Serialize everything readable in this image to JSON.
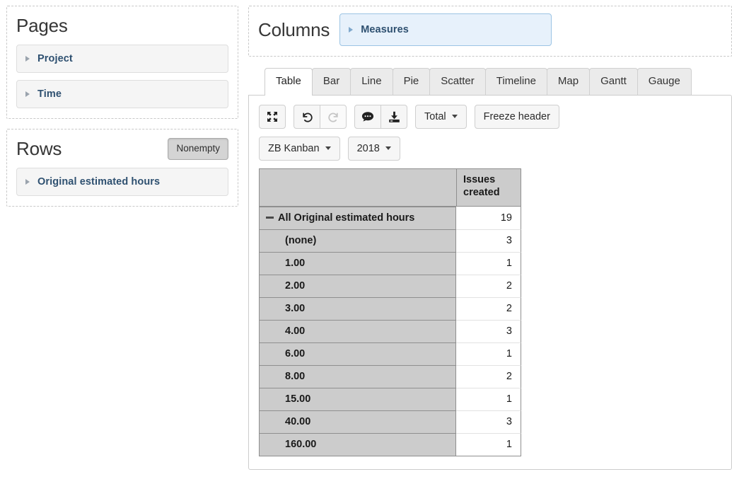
{
  "pages_panel": {
    "title": "Pages",
    "items": [
      {
        "label": "Project",
        "icon": "chevron-right-icon"
      },
      {
        "label": "Time",
        "icon": "chevron-right-icon"
      }
    ]
  },
  "rows_panel": {
    "title": "Rows",
    "nonempty_label": "Nonempty",
    "items": [
      {
        "label": "Original estimated hours",
        "icon": "chevron-right-icon"
      }
    ]
  },
  "columns_panel": {
    "title": "Columns",
    "items": [
      {
        "label": "Measures",
        "icon": "chevron-right-icon"
      }
    ]
  },
  "tabs": [
    {
      "label": "Table",
      "active": true
    },
    {
      "label": "Bar",
      "active": false
    },
    {
      "label": "Line",
      "active": false
    },
    {
      "label": "Pie",
      "active": false
    },
    {
      "label": "Scatter",
      "active": false
    },
    {
      "label": "Timeline",
      "active": false
    },
    {
      "label": "Map",
      "active": false
    },
    {
      "label": "Gantt",
      "active": false
    },
    {
      "label": "Gauge",
      "active": false
    }
  ],
  "toolbar": {
    "fullscreen_icon": "expand-arrows-icon",
    "undo_icon": "undo-arrow-icon",
    "redo_icon": "redo-arrow-icon",
    "comment_icon": "comment-bubble-icon",
    "export_icon": "download-icon",
    "total_label": "Total",
    "freeze_header_label": "Freeze header",
    "project_filter_label": "ZB Kanban",
    "year_filter_label": "2018"
  },
  "chart_data": {
    "type": "table",
    "title": "",
    "row_header": "",
    "columns": [
      "",
      "Issues created"
    ],
    "categories": [
      "All Original estimated hours",
      "(none)",
      "1.00",
      "2.00",
      "3.00",
      "4.00",
      "6.00",
      "8.00",
      "15.00",
      "40.00",
      "160.00"
    ],
    "values": [
      19,
      3,
      1,
      2,
      2,
      3,
      1,
      2,
      1,
      3,
      1
    ],
    "rows": [
      {
        "label": "All Original estimated hours",
        "value": "19",
        "total": true,
        "indent": false,
        "toggle": "minus"
      },
      {
        "label": "(none)",
        "value": "3",
        "total": false,
        "indent": true,
        "toggle": ""
      },
      {
        "label": "1.00",
        "value": "1",
        "total": false,
        "indent": true,
        "toggle": ""
      },
      {
        "label": "2.00",
        "value": "2",
        "total": false,
        "indent": true,
        "toggle": ""
      },
      {
        "label": "3.00",
        "value": "2",
        "total": false,
        "indent": true,
        "toggle": ""
      },
      {
        "label": "4.00",
        "value": "3",
        "total": false,
        "indent": true,
        "toggle": ""
      },
      {
        "label": "6.00",
        "value": "1",
        "total": false,
        "indent": true,
        "toggle": ""
      },
      {
        "label": "8.00",
        "value": "2",
        "total": false,
        "indent": true,
        "toggle": ""
      },
      {
        "label": "15.00",
        "value": "1",
        "total": false,
        "indent": true,
        "toggle": ""
      },
      {
        "label": "40.00",
        "value": "3",
        "total": false,
        "indent": true,
        "toggle": ""
      },
      {
        "label": "160.00",
        "value": "1",
        "total": false,
        "indent": true,
        "toggle": ""
      }
    ]
  },
  "colors": {
    "chip_text": "#2e5070",
    "measures_bg": "#e7f1fb",
    "measures_border": "#9cc4e4",
    "table_header_bg": "#cccccc",
    "table_border": "#8f8f8f"
  }
}
